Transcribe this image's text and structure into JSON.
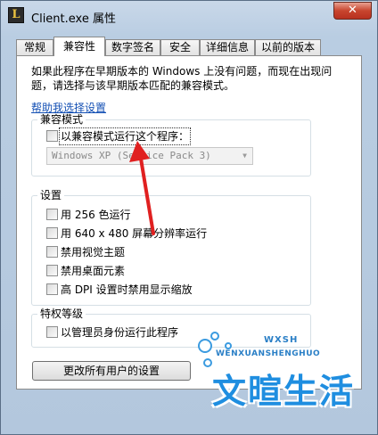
{
  "window": {
    "title": "Client.exe 属性",
    "icon_letter": "L",
    "close_symbol": "✕"
  },
  "tabs": [
    {
      "label": "常规",
      "active": false
    },
    {
      "label": "兼容性",
      "active": true
    },
    {
      "label": "数字签名",
      "active": false
    },
    {
      "label": "安全",
      "active": false
    },
    {
      "label": "详细信息",
      "active": false
    },
    {
      "label": "以前的版本",
      "active": false
    }
  ],
  "compat": {
    "description": "如果此程序在早期版本的 Windows 上没有问题，而现在出现问题，请选择与该早期版本匹配的兼容模式。",
    "help_link": "帮助我选择设置",
    "mode_group": {
      "label": "兼容模式",
      "checkbox_label": "以兼容模式运行这个程序：",
      "checked": false,
      "os_selected": "Windows XP (Service Pack 3)"
    },
    "settings_group": {
      "label": "设置",
      "items": [
        {
          "label": "用 256 色运行",
          "checked": false
        },
        {
          "label": "用 640 x 480 屏幕分辨率运行",
          "checked": false
        },
        {
          "label": "禁用视觉主题",
          "checked": false
        },
        {
          "label": "禁用桌面元素",
          "checked": false
        },
        {
          "label": "高 DPI 设置时禁用显示缩放",
          "checked": false
        }
      ]
    },
    "privilege_group": {
      "label": "特权等级",
      "checkbox_label": "以管理员身份运行此程序",
      "checked": false
    },
    "change_all_button": "更改所有用户的设置"
  },
  "watermark": {
    "small_text": "WXSH",
    "pinyin": "WENXUANSHENGHUO",
    "big_text": "文暄生活"
  },
  "colors": {
    "annotation_arrow": "#e02020",
    "link": "#1450b4",
    "watermark": "#1f8ee0"
  }
}
